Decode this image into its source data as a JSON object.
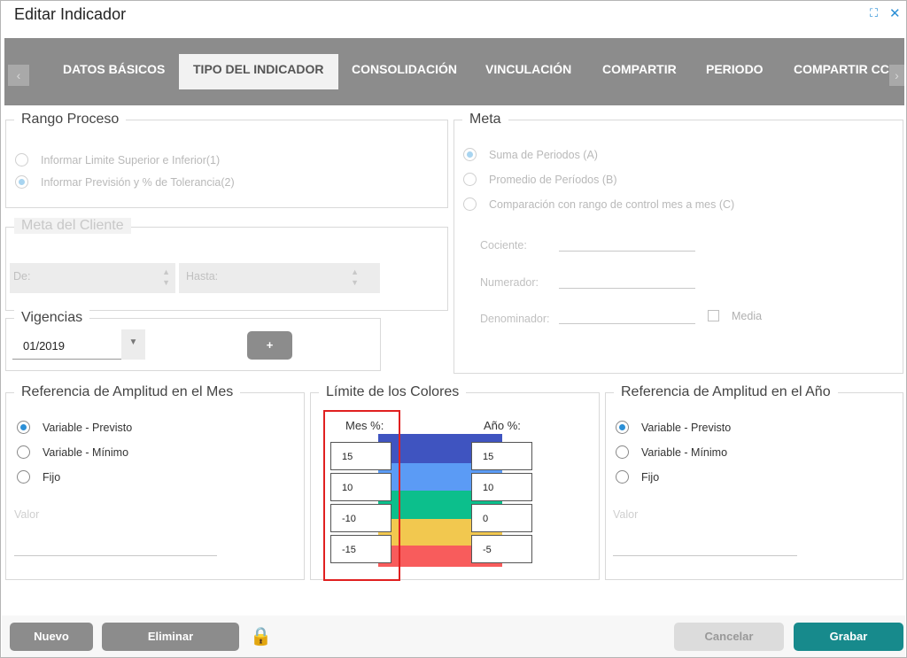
{
  "window": {
    "title": "Editar Indicador",
    "expand_icon": "⛶",
    "close_icon": "✕"
  },
  "tabs": [
    {
      "label": "DATOS BÁSICOS",
      "active": false
    },
    {
      "label": "TIPO DEL INDICADOR",
      "active": true
    },
    {
      "label": "CONSOLIDACIÓN",
      "active": false
    },
    {
      "label": "VINCULACIÓN",
      "active": false
    },
    {
      "label": "COMPARTIR",
      "active": false
    },
    {
      "label": "PERIODO",
      "active": false
    },
    {
      "label": "COMPARTIR CC",
      "active": false
    }
  ],
  "rango_proceso": {
    "legend": "Rango Proceso",
    "options": [
      {
        "label": "Informar Limite Superior e Inferior(1)",
        "selected": false
      },
      {
        "label": "Informar Previsión y % de Tolerancia(2)",
        "selected": true
      }
    ]
  },
  "meta_cliente": {
    "legend": "Meta del Cliente",
    "de_label": "De:",
    "hasta_label": "Hasta:"
  },
  "vigencias": {
    "legend": "Vigencias",
    "selected": "01/2019",
    "add_label": "+"
  },
  "meta": {
    "legend": "Meta",
    "options": [
      {
        "label": "Suma de Periodos (A)",
        "selected": true
      },
      {
        "label": "Promedio de Períodos (B)",
        "selected": false
      },
      {
        "label": "Comparación con rango de control mes a mes (C)",
        "selected": false
      }
    ],
    "cociente_label": "Cociente:",
    "numerador_label": "Numerador:",
    "denominador_label": "Denominador:",
    "media_label": "Media"
  },
  "ref_mes": {
    "legend": "Referencia de Amplitud en el Mes",
    "options": [
      {
        "label": "Variable - Previsto",
        "selected": true
      },
      {
        "label": "Variable - Mínimo",
        "selected": false
      },
      {
        "label": "Fijo",
        "selected": false
      }
    ],
    "valor_label": "Valor"
  },
  "limite_colores": {
    "legend": "Límite de los Colores",
    "mes_label": "Mes %:",
    "anio_label": "Año %:",
    "mes_values": [
      "15",
      "10",
      "-10",
      "-15"
    ],
    "anio_values": [
      "15",
      "10",
      "0",
      "-5"
    ],
    "band_colors": [
      "#3f54c0",
      "#5b9bf5",
      "#0cbf8c",
      "#f2c84f",
      "#f85c5c"
    ]
  },
  "ref_anio": {
    "legend": "Referencia de Amplitud en el Año",
    "options": [
      {
        "label": "Variable - Previsto",
        "selected": true
      },
      {
        "label": "Variable - Mínimo",
        "selected": false
      },
      {
        "label": "Fijo",
        "selected": false
      }
    ],
    "valor_label": "Valor"
  },
  "footer": {
    "nuevo": "Nuevo",
    "eliminar": "Eliminar",
    "lock_icon": "🔒",
    "cancelar": "Cancelar",
    "grabar": "Grabar"
  },
  "colors": {
    "accent": "#2b8fd6",
    "grabar": "#178a8c",
    "tabbar": "#8c8c8c",
    "highlight": "#e02020"
  }
}
